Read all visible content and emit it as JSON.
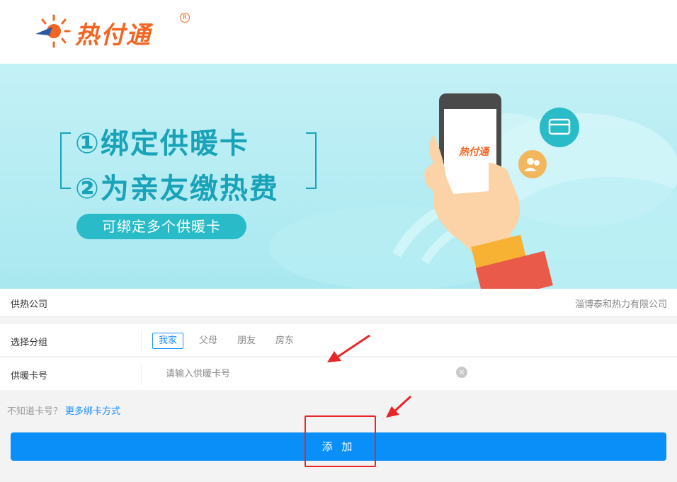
{
  "header": {
    "logo_text": "热付通",
    "logo_reg": "R"
  },
  "banner": {
    "line1": "①绑定供暖卡",
    "line2": "②为亲友缴热费",
    "pill": "可绑定多个供暖卡",
    "phone_logo": "热付通"
  },
  "company": {
    "label": "供热公司",
    "value": "淄博泰和热力有限公司"
  },
  "group": {
    "label": "选择分组",
    "options": [
      "我家",
      "父母",
      "朋友",
      "房东"
    ],
    "selected": "我家"
  },
  "card": {
    "label": "供暖卡号",
    "placeholder": "请输入供暖卡号",
    "value": "",
    "clear_icon": "×"
  },
  "help": {
    "question": "不知道卡号？",
    "link": "更多绑卡方式"
  },
  "add_button": {
    "label": "添 加"
  },
  "colors": {
    "accent": "#0a8ff8",
    "logo_orange": "#f26522",
    "banner_teal": "#1aa3b8",
    "annotation_red": "#e8262a"
  }
}
